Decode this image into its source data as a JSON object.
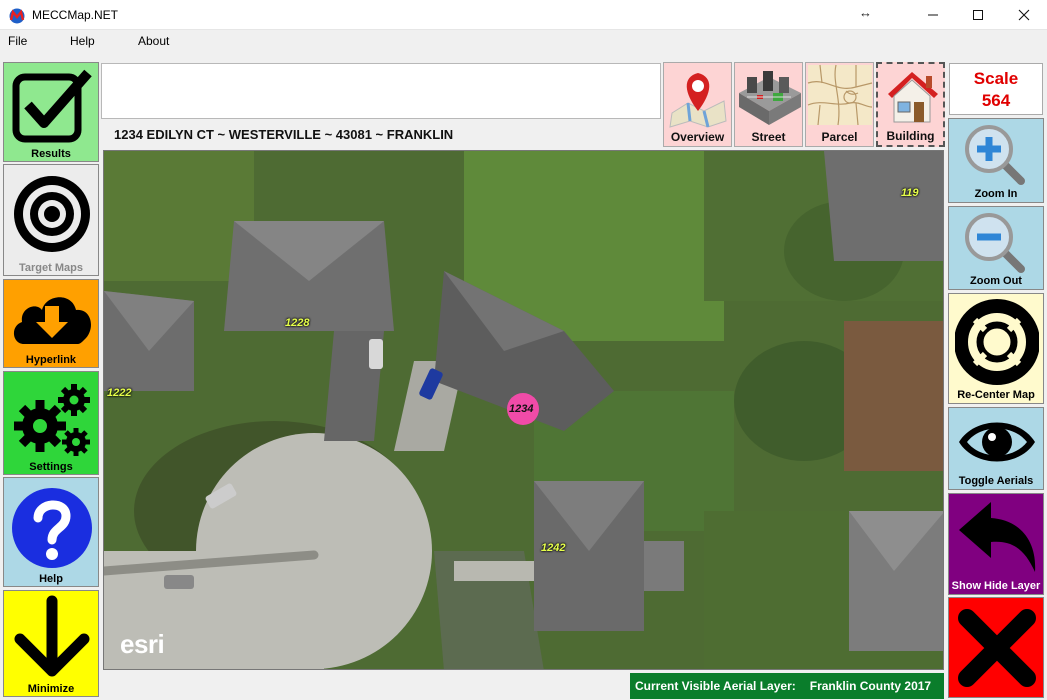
{
  "window": {
    "title": "MECCMap.NET",
    "resize_glyph": "↔",
    "minimize_glyph": "—",
    "maximize_glyph": "☐",
    "close_glyph": "✕"
  },
  "menu": [
    "File",
    "Help",
    "About"
  ],
  "left_buttons": [
    {
      "label": "Results",
      "icon": "checkmark-icon",
      "color": "#8fe88f"
    },
    {
      "label": "Target Maps",
      "icon": "target-icon",
      "color": "#ececec"
    },
    {
      "label": "Hyperlink",
      "icon": "cloud-download-icon",
      "color": "#ffa000"
    },
    {
      "label": "Settings",
      "icon": "gears-icon",
      "color": "#2fd63a"
    },
    {
      "label": "Help",
      "icon": "question-icon",
      "color": "#add8e6"
    },
    {
      "label": "Minimize",
      "icon": "arrow-down-icon",
      "color": "#ffff00"
    }
  ],
  "search": {
    "value": ""
  },
  "address": "1234 EDILYN CT ~ WESTERVILLE ~ 43081 ~ FRANKLIN",
  "map_types": [
    {
      "label": "Overview",
      "icon": "map-pin-icon"
    },
    {
      "label": "Street",
      "icon": "street-icon"
    },
    {
      "label": "Parcel",
      "icon": "parcel-icon"
    },
    {
      "label": "Building",
      "icon": "house-icon",
      "selected": true
    }
  ],
  "scale": {
    "label": "Scale",
    "value": "564"
  },
  "right_buttons": [
    {
      "label": "Zoom In",
      "icon": "zoom-in-icon",
      "color": "#add8e6"
    },
    {
      "label": "Zoom Out",
      "icon": "zoom-out-icon",
      "color": "#add8e6"
    },
    {
      "label": "Re-Center Map",
      "icon": "lifebuoy-icon",
      "color": "#fffacd"
    },
    {
      "label": "Toggle Aerials",
      "icon": "eye-icon",
      "color": "#add8e6"
    },
    {
      "label": "Show Hide Layer",
      "icon": "back-arrow-icon",
      "color": "#800080"
    },
    {
      "label": "",
      "icon": "close-x-icon",
      "color": "#ff0000"
    }
  ],
  "parcels": [
    "1228",
    "1222",
    "1234",
    "1242",
    "119"
  ],
  "map_attribution": "esri",
  "status": {
    "label": "Current Visible Aerial Layer:",
    "value": "Franklin County 2017"
  }
}
